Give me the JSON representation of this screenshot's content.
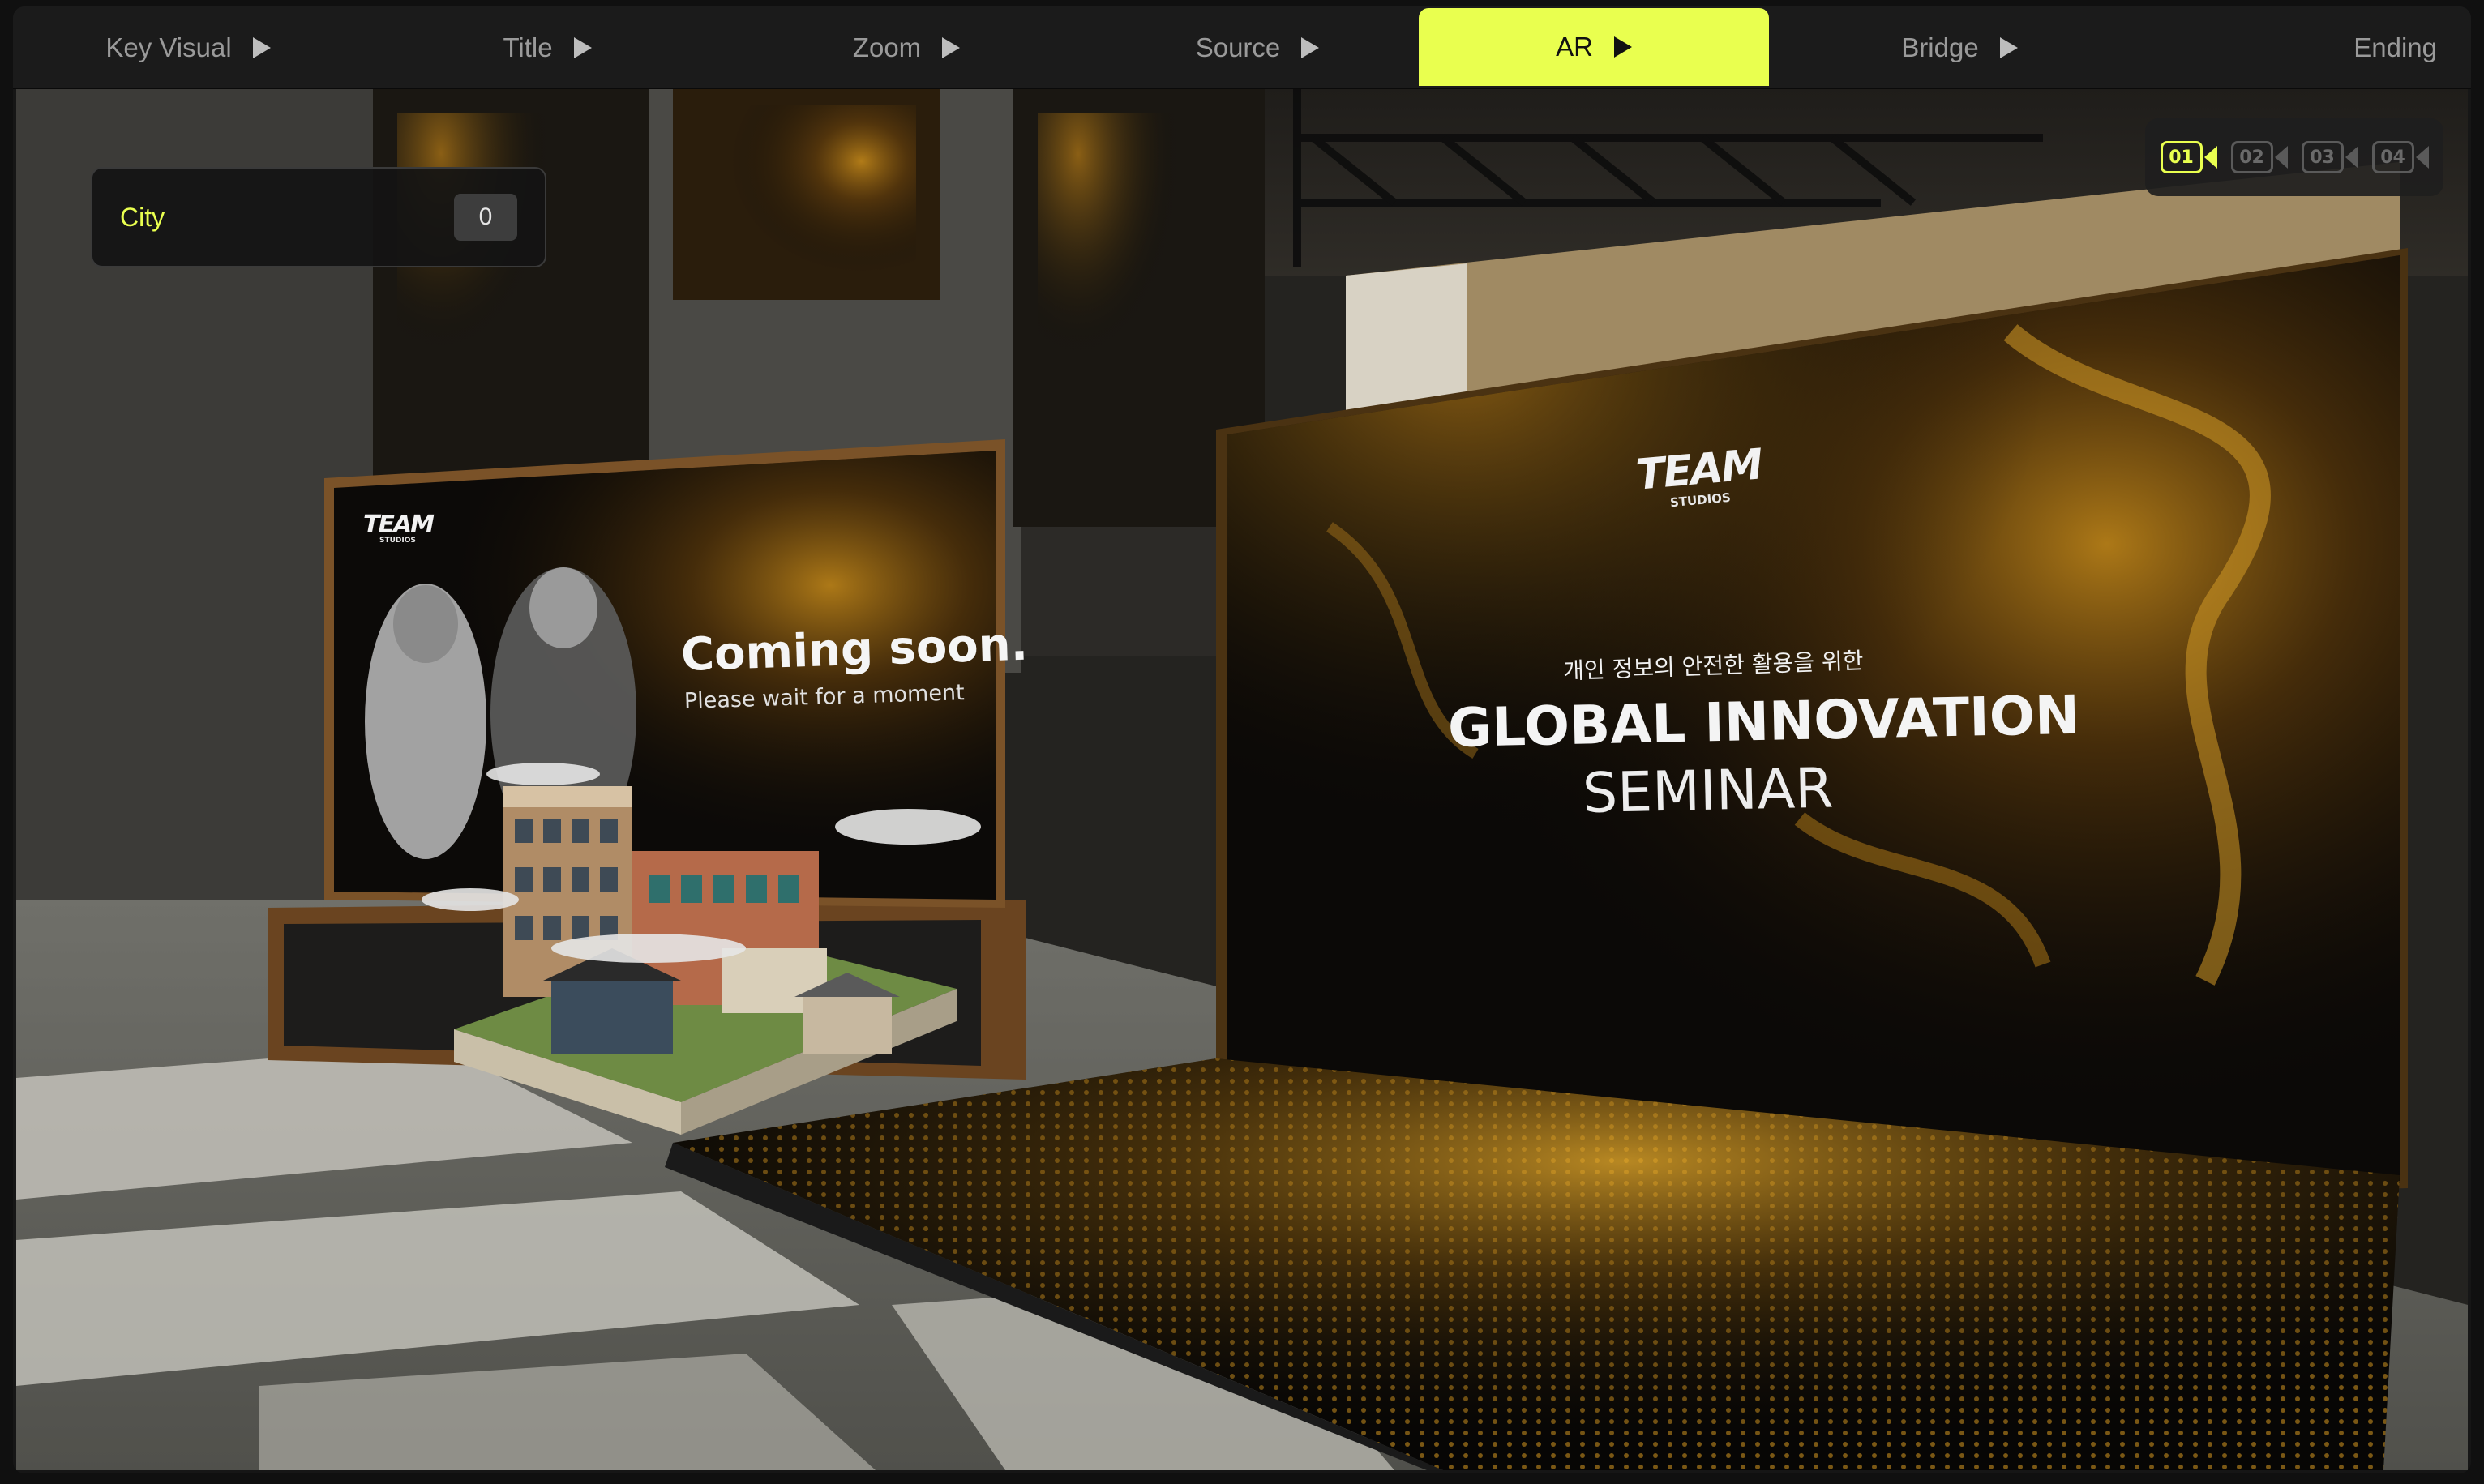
{
  "nav": {
    "tabs": [
      {
        "label": "Key Visual",
        "has_play": true,
        "active": false
      },
      {
        "label": "Title",
        "has_play": true,
        "active": false
      },
      {
        "label": "Zoom",
        "has_play": true,
        "active": false
      },
      {
        "label": "Source",
        "has_play": true,
        "active": false
      },
      {
        "label": "AR",
        "has_play": true,
        "active": true
      },
      {
        "label": "Bridge",
        "has_play": true,
        "active": false
      },
      {
        "label": "Ending",
        "has_play": false,
        "active": false
      }
    ],
    "play_icon": "play-icon",
    "active_color": "#e9ff4f"
  },
  "city_panel": {
    "label": "City",
    "count": "0"
  },
  "cameras": {
    "items": [
      {
        "label": "01",
        "active": true
      },
      {
        "label": "02",
        "active": false
      },
      {
        "label": "03",
        "active": false
      },
      {
        "label": "04",
        "active": false
      }
    ],
    "icon": "video-camera-icon"
  },
  "main_screen": {
    "logo": "TEAM",
    "logo_sub": "STUDIOS",
    "korean_subtitle": "개인 정보의 안전한 활용을 위한",
    "headline": "GLOBAL INNOVATION",
    "subheadline": "SEMINAR"
  },
  "side_screen": {
    "logo": "TEAM",
    "logo_sub": "STUDIOS",
    "title": "Coming soon.",
    "subtitle": "Please wait for a moment"
  },
  "colors": {
    "accent": "#e9ff4f",
    "gold": "#c8901c"
  }
}
